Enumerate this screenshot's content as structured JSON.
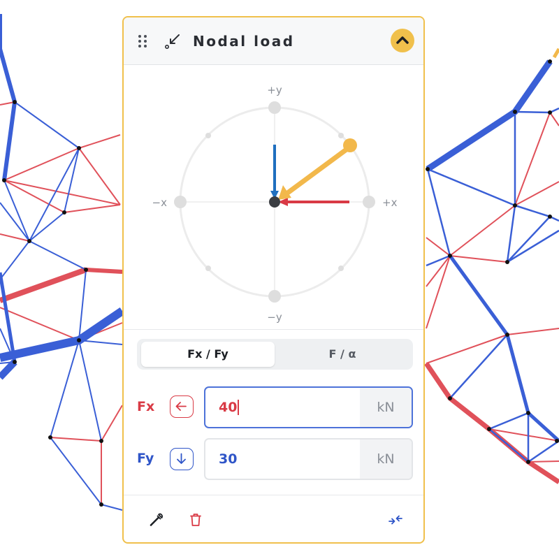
{
  "panel": {
    "title": "Nodal load",
    "icons": {
      "drag": "drag-handle-icon",
      "load": "arrow-down-left-icon",
      "collapse": "chevron-up-icon",
      "pick": "eyedropper-icon",
      "delete": "trash-icon",
      "compress": "arrows-in-icon"
    }
  },
  "compass": {
    "label_pos_y": "+y",
    "label_neg_y": "−y",
    "label_pos_x": "+x",
    "label_neg_x": "−x"
  },
  "mode_toggle": {
    "options": [
      "Fx / Fy",
      "F / α"
    ],
    "selected": "Fx / Fy"
  },
  "fields": {
    "fx": {
      "label": "Fx",
      "value": "40",
      "unit": "kN",
      "direction": "left-arrow-icon",
      "focused": true
    },
    "fy": {
      "label": "Fy",
      "value": "30",
      "unit": "kN",
      "direction": "down-arrow-icon"
    }
  },
  "colors": {
    "accent": "#f0c04c",
    "fx": "#d93a45",
    "fy": "#2f55c8",
    "resultant": "#f2b84b",
    "fy_vector": "#1f6fbf",
    "truss_red": "#e0515a",
    "truss_blue": "#3a5fd6"
  }
}
